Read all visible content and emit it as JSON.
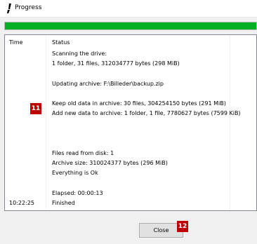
{
  "window": {
    "title": "Progress"
  },
  "progress": {
    "percent": 100,
    "color": "#06b025"
  },
  "log": {
    "headers": {
      "time": "Time",
      "status": "Status"
    },
    "rows": [
      {
        "time": "",
        "status": "Scanning the drive:"
      },
      {
        "time": "",
        "status": "1 folder, 31 files, 312034777 bytes (298 MiB)"
      },
      {
        "time": "",
        "status": ""
      },
      {
        "time": "",
        "status": "Updating archive: F:\\Billeder\\backup.zip"
      },
      {
        "time": "",
        "status": ""
      },
      {
        "time": "",
        "status": "Keep old data in archive: 30 files, 304254150 bytes (291 MiB)"
      },
      {
        "time": "",
        "status": "Add new data to archive: 1 folder, 1 file, 7780627 bytes (7599 KiB)"
      },
      {
        "time": "",
        "status": ""
      },
      {
        "time": "",
        "status": ""
      },
      {
        "time": "",
        "status": ""
      },
      {
        "time": "",
        "status": "Files read from disk: 1"
      },
      {
        "time": "",
        "status": "Archive size: 310024377 bytes (296 MiB)"
      },
      {
        "time": "",
        "status": "Everything is Ok"
      },
      {
        "time": "",
        "status": ""
      },
      {
        "time": "",
        "status": "Elapsed: 00:00:13"
      },
      {
        "time": "10:22:25",
        "status": "Finished"
      }
    ]
  },
  "annotations": {
    "badge_a": "11",
    "badge_b": "12",
    "badge_color": "#c00000"
  },
  "buttons": {
    "close_label": "Close"
  }
}
